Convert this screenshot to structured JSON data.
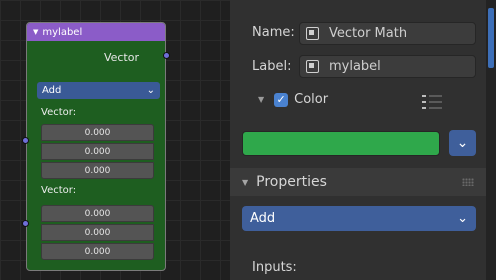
{
  "node": {
    "header_label": "mylabel",
    "output_label": "Vector",
    "operation": "Add",
    "inputs": [
      {
        "label": "Vector:",
        "values": [
          "0.000",
          "0.000",
          "0.000"
        ]
      },
      {
        "label": "Vector:",
        "values": [
          "0.000",
          "0.000",
          "0.000"
        ]
      }
    ]
  },
  "panel": {
    "name_label": "Name:",
    "name_value": "Vector Math",
    "label_label": "Label:",
    "label_value": "mylabel",
    "color_label": "Color",
    "color_checked": true,
    "color_value": "#2fa84b",
    "properties_label": "Properties",
    "operation": "Add",
    "inputs_label": "Inputs:"
  },
  "colors": {
    "node_header": "#8b5cc8",
    "node_body": "#1e5e20",
    "accent": "#3f5f9b",
    "socket": "#6f6fd8"
  }
}
